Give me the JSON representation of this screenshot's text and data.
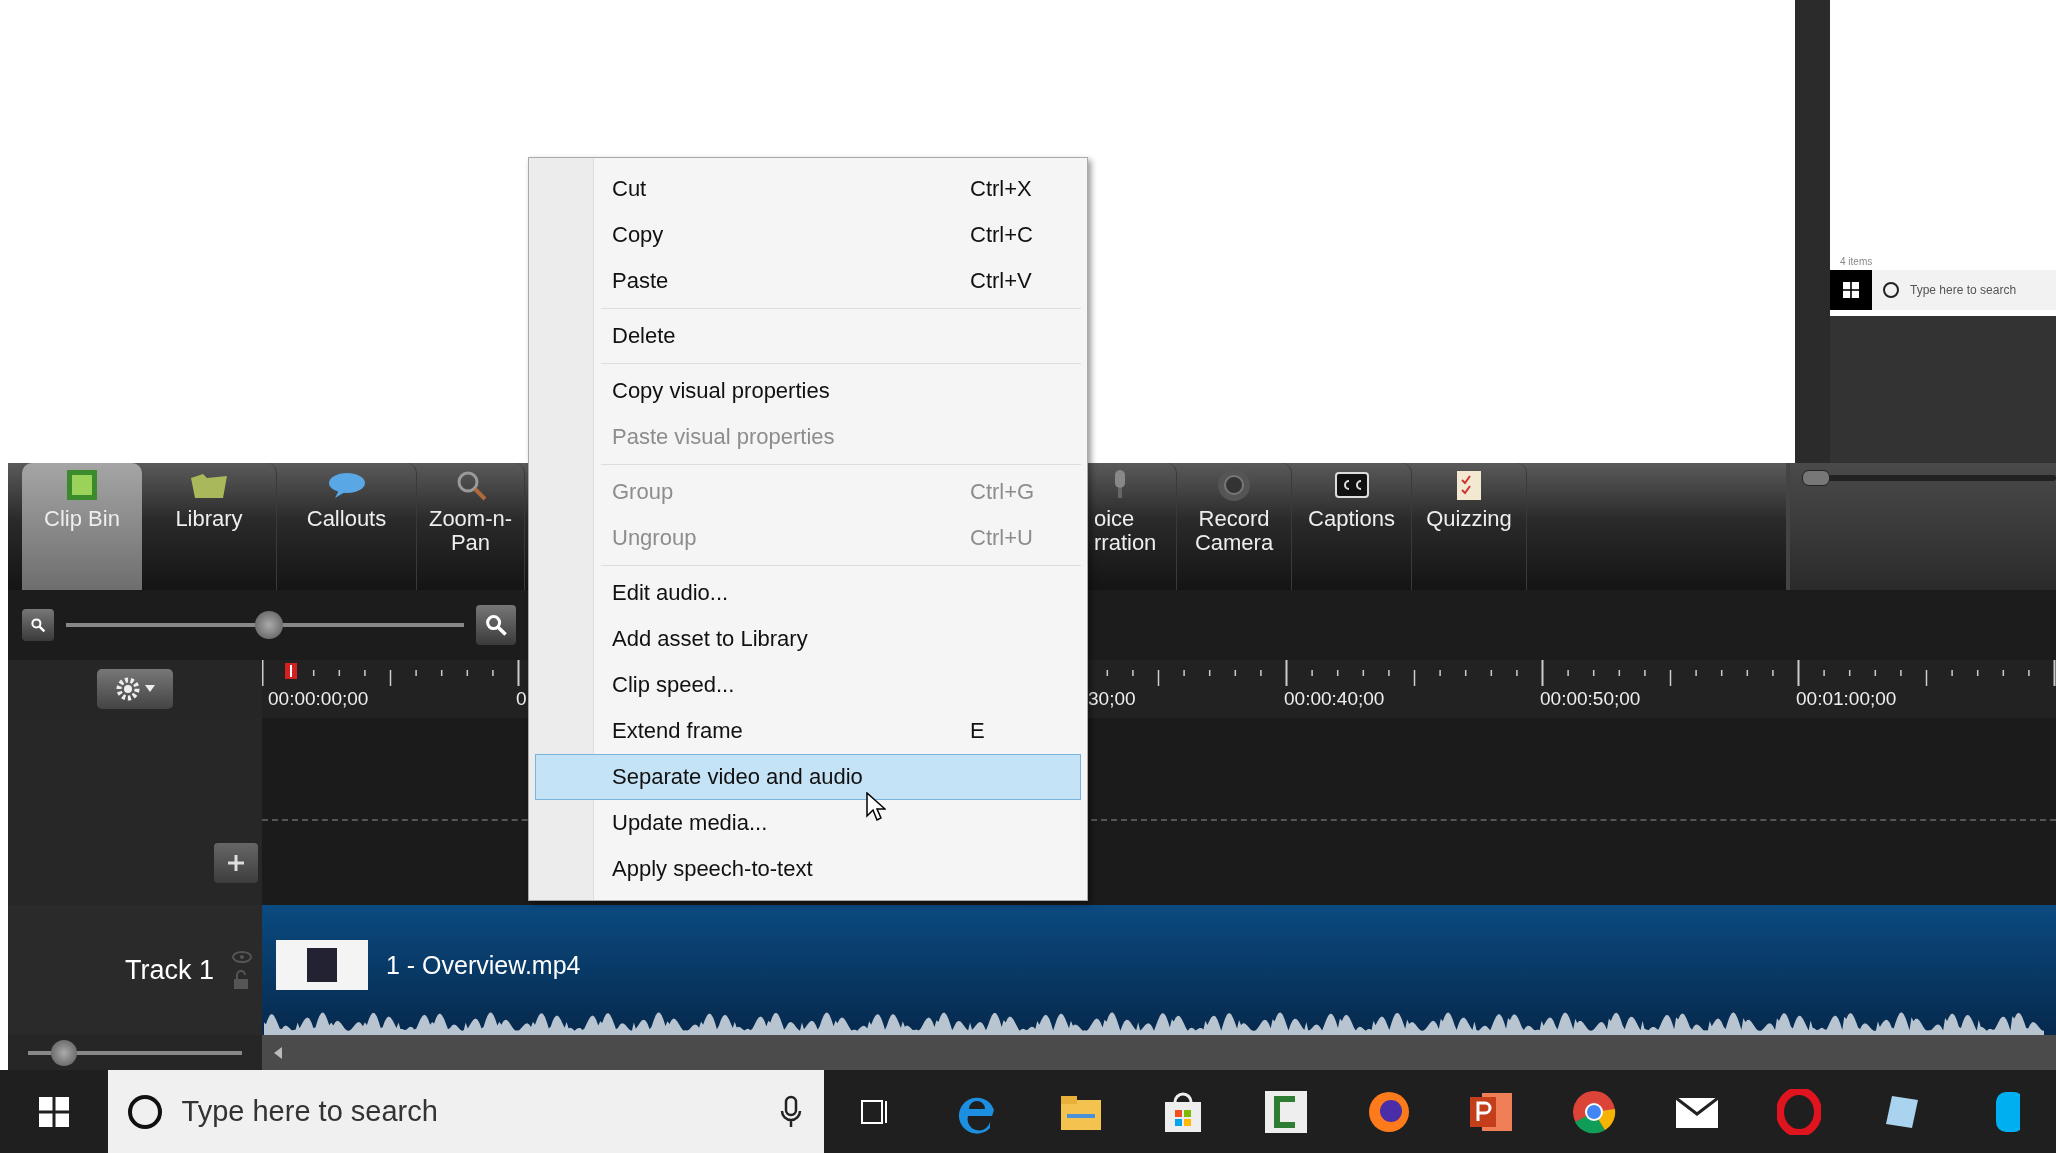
{
  "preview": {
    "caption": "4 items",
    "search_placeholder": "Type here to search"
  },
  "toolbar": {
    "tools": [
      {
        "lines": [
          "Clip Bin"
        ],
        "selected": true
      },
      {
        "lines": [
          "Library"
        ],
        "selected": false
      },
      {
        "lines": [
          "Callouts"
        ],
        "selected": false
      },
      {
        "lines": [
          "Zoom-n-",
          "Pan"
        ],
        "selected": false
      },
      {
        "lines": [
          "oice",
          "rration"
        ],
        "selected": false
      },
      {
        "lines": [
          "Record",
          "Camera"
        ],
        "selected": false
      },
      {
        "lines": [
          "Captions"
        ],
        "selected": false
      },
      {
        "lines": [
          "Quizzing"
        ],
        "selected": false
      }
    ]
  },
  "timeline": {
    "zoom": {
      "level": 0.51
    },
    "ruler_labels": [
      "00:00:00;00",
      "0",
      "30;00",
      "00:00:40;00",
      "00:00:50;00",
      "00:01:00;00"
    ],
    "tracks": [
      {
        "name": "Track 1",
        "clip": "1 - Overview.mp4"
      }
    ],
    "track_height": {
      "level": 0.12
    }
  },
  "context_menu": {
    "items": [
      {
        "label": "Cut",
        "shortcut": "Ctrl+X",
        "disabled": false,
        "selected": false,
        "separator_after": false
      },
      {
        "label": "Copy",
        "shortcut": "Ctrl+C",
        "disabled": false,
        "selected": false,
        "separator_after": false
      },
      {
        "label": "Paste",
        "shortcut": "Ctrl+V",
        "disabled": false,
        "selected": false,
        "separator_after": true
      },
      {
        "label": "Delete",
        "disabled": false,
        "selected": false,
        "separator_after": true
      },
      {
        "label": "Copy visual properties",
        "disabled": false,
        "selected": false,
        "separator_after": false
      },
      {
        "label": "Paste visual properties",
        "disabled": true,
        "selected": false,
        "separator_after": true
      },
      {
        "label": "Group",
        "shortcut": "Ctrl+G",
        "disabled": true,
        "selected": false,
        "separator_after": false
      },
      {
        "label": "Ungroup",
        "shortcut": "Ctrl+U",
        "disabled": true,
        "selected": false,
        "separator_after": true
      },
      {
        "label": "Edit audio...",
        "disabled": false,
        "selected": false,
        "separator_after": false
      },
      {
        "label": "Add asset to Library",
        "disabled": false,
        "selected": false,
        "separator_after": false
      },
      {
        "label": "Clip speed...",
        "disabled": false,
        "selected": false,
        "separator_after": false
      },
      {
        "label": "Extend frame",
        "shortcut": "E",
        "disabled": false,
        "selected": false,
        "separator_after": false
      },
      {
        "label": "Separate video and audio",
        "disabled": false,
        "selected": true,
        "separator_after": false
      },
      {
        "label": "Update media...",
        "disabled": false,
        "selected": false,
        "separator_after": false
      },
      {
        "label": "Apply speech-to-text",
        "disabled": false,
        "selected": false,
        "separator_after": false
      }
    ]
  },
  "taskbar": {
    "search_placeholder": "Type here to search"
  }
}
